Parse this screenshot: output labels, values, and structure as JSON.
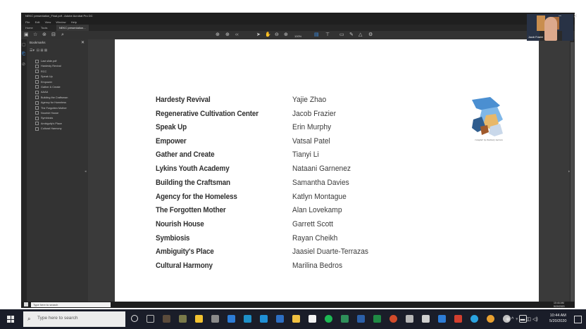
{
  "window": {
    "title": "NEKC presentation_Final.pdf - Adobe Acrobat Pro DC",
    "menu": [
      "File",
      "Edit",
      "View",
      "Window",
      "Help"
    ],
    "tabs": [
      {
        "label": "Home"
      },
      {
        "label": "Tools"
      },
      {
        "label": "NEKC presentation..."
      }
    ],
    "zoom": "100%"
  },
  "sidebar": {
    "header": "Bookmarks",
    "items": [
      {
        "label": "Last slide.pdf"
      },
      {
        "label": "Hardesty Revival"
      },
      {
        "label": "RCC"
      },
      {
        "label": "Speak Up"
      },
      {
        "label": "Empower"
      },
      {
        "label": "Gather & Create"
      },
      {
        "label": "AAAA"
      },
      {
        "label": "Building the Craftsman"
      },
      {
        "label": "Agency for Homeless"
      },
      {
        "label": "The Forgotten Mother"
      },
      {
        "label": "Nourish House"
      },
      {
        "label": "Symbiosis"
      },
      {
        "label": "Ambiguity's Place"
      },
      {
        "label": "Cultural Harmony"
      }
    ]
  },
  "document": {
    "rows": [
      {
        "project": "Hardesty Revival",
        "name": "Yajie Zhao"
      },
      {
        "project": "Regenerative Cultivation Center",
        "name": "Jacob Frazier"
      },
      {
        "project": "Speak Up",
        "name": "Erin Murphy"
      },
      {
        "project": "Empower",
        "name": "Vatsal Patel"
      },
      {
        "project": "Gather and Create",
        "name": "Tianyi Li"
      },
      {
        "project": "Lykins Youth Academy",
        "name": "Nataani Garnenez"
      },
      {
        "project": "Building the Craftsman",
        "name": "Samantha Davies"
      },
      {
        "project": "Agency for the Homeless",
        "name": "Katlyn Montague"
      },
      {
        "project": "The Forgotten Mother",
        "name": "Alan Lovekamp"
      },
      {
        "project": "Nourish House",
        "name": "Garrett Scott"
      },
      {
        "project": "Symbiosis",
        "name": "Rayan Cheikh"
      },
      {
        "project": "Ambiguity's Place",
        "name": "Jaasiel Duarte-Terrazas"
      },
      {
        "project": "Cultural Harmony",
        "name": "Marilina Bedros"
      }
    ],
    "artwork_caption": "Graphic by Zachary Larson"
  },
  "inner_taskbar": {
    "search_placeholder": "Type here to search",
    "time": "10:44 AM",
    "date": "5/20/2020"
  },
  "taskbar": {
    "search_placeholder": "Type here to search",
    "time": "10:44 AM",
    "date": "5/20/2020"
  },
  "webcam": {
    "label": "Jacob Frazier"
  },
  "colors": {
    "accent": "#3a8ee6",
    "page_bg": "#ffffff",
    "app_bg": "#2b2b2b"
  }
}
